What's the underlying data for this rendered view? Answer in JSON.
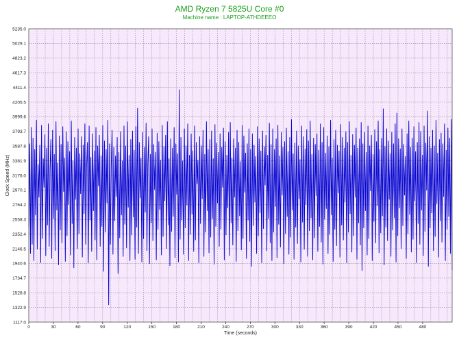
{
  "chart_data": {
    "type": "line",
    "title": "AMD Ryzen 7 5825U Core #0",
    "subtitle": "Machine name : LAPTOP-ATHDEEEO",
    "xlabel": "Time (seconds)",
    "ylabel": "Clock Speed (MHz)",
    "xlim": [
      0,
      516
    ],
    "ylim": [
      1117.0,
      5235.0
    ],
    "x_ticks": [
      0,
      30,
      60,
      90,
      120,
      150,
      180,
      210,
      240,
      270,
      300,
      330,
      360,
      390,
      420,
      450,
      480
    ],
    "y_ticks": [
      "1117.0",
      "1322.9",
      "1528.8",
      "1734.7",
      "1940.6",
      "2146.5",
      "2352.4",
      "2558.3",
      "2764.2",
      "2970.1",
      "3176.0",
      "3381.9",
      "3587.8",
      "3793.7",
      "3999.6",
      "4205.5",
      "4411.4",
      "4617.3",
      "4823.2",
      "5029.1",
      "5235.0"
    ],
    "grid": true,
    "plot_bg": "#f7e8fb",
    "grid_color": "#9a86a6",
    "line_color": "#0a0ad0",
    "title_color": "#1a9e1a",
    "series": [
      {
        "values": [
          2450,
          3620,
          2080,
          3850,
          2210,
          3700,
          1980,
          3540,
          2620,
          3950,
          2140,
          3330,
          2870,
          3600,
          1950,
          3880,
          2290,
          3410,
          3010,
          3750,
          2050,
          3560,
          2480,
          3900,
          2180,
          3240,
          3680,
          2010,
          3810,
          2570,
          3470,
          2120,
          3930,
          2690,
          3350,
          1920,
          3730,
          2410,
          3610,
          2230,
          3860,
          2950,
          3420,
          1970,
          3790,
          2330,
          3650,
          2770,
          3510,
          2060,
          3940,
          2500,
          3380,
          1880,
          3710,
          2840,
          3560,
          2150,
          3830,
          2360,
          3480,
          2920,
          3720,
          2030,
          3600,
          2640,
          3900,
          2210,
          3310,
          3640,
          1950,
          3870,
          2550,
          3430,
          2110,
          3760,
          2680,
          3520,
          2270,
          3850,
          1990,
          3590,
          3030,
          3740,
          2180,
          3450,
          2460,
          3880,
          1830,
          3660,
          2380,
          3540,
          2790,
          3950,
          1360,
          3620,
          2210,
          3320,
          3810,
          2070,
          3570,
          2540,
          3450,
          2880,
          3710,
          1800,
          3500,
          2300,
          3790,
          2620,
          3380,
          2040,
          3870,
          2490,
          3590,
          2160,
          3930,
          2730,
          3460,
          1980,
          3680,
          2340,
          3800,
          2590,
          3530,
          2000,
          3860,
          2450,
          4120,
          2080,
          3640,
          2860,
          3420,
          1960,
          3780,
          2290,
          3570,
          2660,
          3910,
          2120,
          3350,
          3720,
          1940,
          3470,
          2510,
          3830,
          2260,
          3610,
          2980,
          3500,
          1990,
          3770,
          2420,
          3650,
          2700,
          3390,
          2060,
          3880,
          2320,
          3580,
          2820,
          3740,
          2150,
          3930,
          2480,
          3410,
          1910,
          3690,
          2390,
          3560,
          2600,
          3850,
          2020,
          3620,
          2910,
          3480,
          1960,
          4380,
          2280,
          3710,
          2550,
          3380,
          2070,
          3830,
          2440,
          3590,
          2760,
          3900,
          1980,
          3460,
          2350,
          3760,
          2630,
          3520,
          2110,
          3870,
          2270,
          3640,
          3060,
          3390,
          1950,
          3720,
          2500,
          3590,
          2850,
          3810,
          2040,
          3470,
          2380,
          3930,
          2680,
          3540,
          2090,
          3680,
          2310,
          3800,
          2570,
          3410,
          1930,
          3890,
          2460,
          3630,
          2790,
          3500,
          2180,
          3760,
          2420,
          3570,
          3010,
          3840,
          1990,
          3650,
          2340,
          3460,
          2720,
          3780,
          2050,
          3920,
          2510,
          3420,
          2200,
          3690,
          2870,
          3560,
          1970,
          3810,
          2400,
          3640,
          2610,
          3370,
          2130,
          3880,
          2290,
          3730,
          2940,
          3490,
          2010,
          3620,
          2550,
          3830,
          2250,
          3540,
          1900,
          3760,
          2470,
          3600,
          2800,
          3440,
          2080,
          3860,
          2330,
          3690,
          2650,
          3520,
          1950,
          3800,
          2430,
          3580,
          3040,
          3740,
          2120,
          3460,
          2570,
          3910,
          2230,
          3610,
          1980,
          3830,
          2380,
          3540,
          2740,
          3690,
          2020,
          3880,
          2490,
          3450,
          2170,
          3780,
          2900,
          3570,
          1940,
          3650,
          2360,
          3840,
          2600,
          3510,
          2070,
          3710,
          2310,
          3960,
          2690,
          3480,
          2000,
          3630,
          2450,
          3800,
          2220,
          3590,
          2850,
          3400,
          1960,
          3870,
          2520,
          3720,
          2140,
          3550,
          2770,
          3820,
          2040,
          3660,
          2400,
          3940,
          2580,
          3470,
          1990,
          3700,
          2300,
          3610,
          2890,
          3760,
          2110,
          3530,
          2460,
          3900,
          2240,
          3640,
          1930,
          3850,
          2560,
          3490,
          2710,
          3730,
          2080,
          3580,
          2350,
          3950,
          2620,
          3420,
          1970,
          3680,
          2420,
          3810,
          2190,
          3600,
          2930,
          3520,
          2030,
          3890,
          2480,
          3710,
          2270,
          3560,
          2800,
          3790,
          1950,
          3640,
          2380,
          3930,
          2640,
          3460,
          2100,
          3750,
          2330,
          3600,
          2870,
          3840,
          2000,
          3560,
          2510,
          3690,
          2200,
          3920,
          1840,
          3620,
          2440,
          3780,
          2680,
          3500,
          2060,
          3870,
          2290,
          3590,
          2960,
          3740,
          1980,
          3470,
          2530,
          3820,
          2230,
          3650,
          2750,
          3940,
          2090,
          3540,
          2370,
          3700,
          2610,
          4110,
          1920,
          3580,
          2450,
          3830,
          2260,
          3660,
          2840,
          3480,
          2040,
          3780,
          2410,
          3620,
          2580,
          3900,
          1960,
          4050,
          2330,
          3690,
          2720,
          3550,
          2150,
          3830,
          2470,
          3610,
          2900,
          3440,
          2010,
          3760,
          2360,
          3940,
          2630,
          3570,
          2100,
          3700,
          2280,
          3860,
          2820,
          3510,
          1950,
          3640,
          2500,
          3920,
          2210,
          3790,
          2690,
          3460,
          2050,
          3870,
          2390,
          3630,
          2970,
          4080,
          1900,
          3720,
          2440,
          3560,
          2650,
          3810,
          2120,
          3590,
          2320,
          3950,
          2780,
          3490,
          2030,
          3680,
          2540,
          3770,
          2240,
          3620,
          2880,
          3900,
          1980,
          3530,
          2420,
          3840,
          2600,
          3700,
          2080,
          3960,
          1850
        ]
      }
    ]
  }
}
